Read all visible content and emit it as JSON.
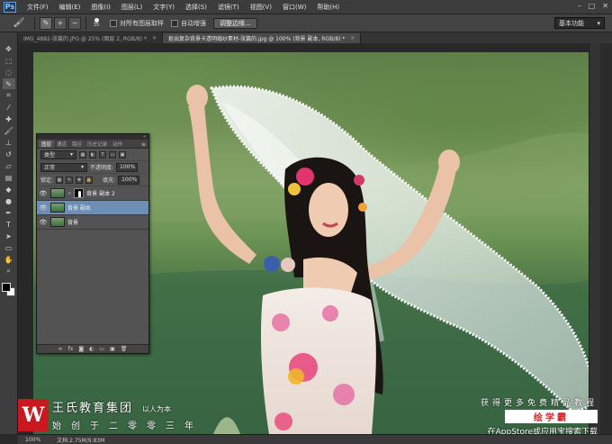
{
  "menu": {
    "logo": "Ps",
    "items": [
      "文件(F)",
      "编辑(E)",
      "图像(I)",
      "图层(L)",
      "文字(Y)",
      "选择(S)",
      "滤镜(T)",
      "视图(V)",
      "窗口(W)",
      "帮助(H)"
    ],
    "window_controls": [
      "–",
      "□",
      "✕"
    ]
  },
  "options": {
    "tool_icon": "brush-icon",
    "brush_size": "35",
    "checkbox1": "对所有图层取样",
    "checkbox2": "自动增强",
    "refine_edge": "调整边缘...",
    "workspace": "基本功能"
  },
  "tabs": [
    {
      "label": "IMG_4882-张篇的.JPG @ 25% (图层 2, RGB/8) *",
      "active": false
    },
    {
      "label": "抠出复杂背景卡透明婚纱素材-张篇的.jpg @ 100% (背景 副本, RGB/8) *",
      "active": true
    }
  ],
  "tools": [
    "move-icon",
    "marquee-icon",
    "lasso-icon",
    "quick-select-icon",
    "crop-icon",
    "eyedropper-icon",
    "healing-icon",
    "brush-icon",
    "stamp-icon",
    "history-brush-icon",
    "eraser-icon",
    "gradient-icon",
    "blur-icon",
    "dodge-icon",
    "pen-icon",
    "type-icon",
    "path-select-icon",
    "shape-icon",
    "hand-icon",
    "zoom-icon"
  ],
  "layers_panel": {
    "tabs": [
      "图层",
      "通道",
      "路径",
      "历史记录",
      "动作"
    ],
    "kind_filter": "类型",
    "blend_mode": "正常",
    "opacity_label": "不透明度:",
    "opacity_value": "100%",
    "lock_label": "锁定:",
    "fill_label": "填充:",
    "fill_value": "100%",
    "layers": [
      {
        "name": "背景 副本 2",
        "selected": false,
        "mask": true
      },
      {
        "name": "背景 副本",
        "selected": true,
        "mask": false
      },
      {
        "name": "背景",
        "selected": false,
        "mask": false
      }
    ],
    "bottom_icons": [
      "∞",
      "fx",
      "◙",
      "◐",
      "▭",
      "▣",
      "🗑"
    ]
  },
  "status": {
    "zoom": "100%",
    "doc_info": "文档:2.75M/9.83M"
  },
  "watermark": {
    "logo_letter": "W",
    "title": "王氏教育集团",
    "slogan": "以人为本",
    "subtitle": "始创于二零零三年",
    "right_line1": "获得更多免费精品教程",
    "right_line2": "绘学霸",
    "right_line3": "在AppStore或应用宝搜索下载"
  },
  "colors": {
    "ui_dark": "#2b2b2b",
    "selected_layer": "#6d8fb5",
    "brand_red": "#c8191e"
  }
}
